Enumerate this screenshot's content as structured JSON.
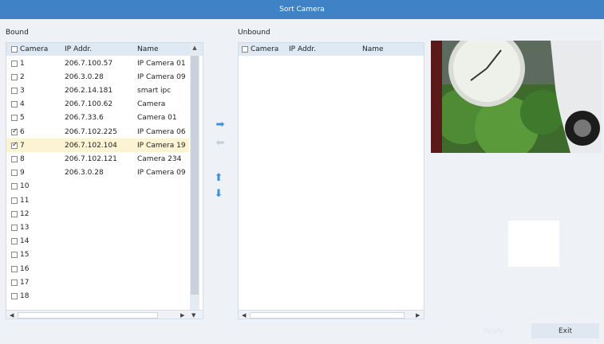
{
  "window": {
    "title": "Sort Camera"
  },
  "bound": {
    "label": "Bound",
    "columns": {
      "camera": "Camera",
      "ip": "IP Addr.",
      "name": "Name"
    },
    "rows": [
      {
        "cam": "1",
        "ip": "206.7.100.57",
        "name": "IP Camera 01",
        "checked": false
      },
      {
        "cam": "2",
        "ip": "206.3.0.28",
        "name": "IP Camera 09",
        "checked": false
      },
      {
        "cam": "3",
        "ip": "206.2.14.181",
        "name": "smart ipc",
        "checked": false
      },
      {
        "cam": "4",
        "ip": "206.7.100.62",
        "name": "Camera",
        "checked": false
      },
      {
        "cam": "5",
        "ip": "206.7.33.6",
        "name": "Camera 01",
        "checked": false
      },
      {
        "cam": "6",
        "ip": "206.7.102.225",
        "name": "IP Camera 06",
        "checked": true
      },
      {
        "cam": "7",
        "ip": "206.7.102.104",
        "name": "IP Camera 19",
        "checked": true
      },
      {
        "cam": "8",
        "ip": "206.7.102.121",
        "name": "Camera 234",
        "checked": false
      },
      {
        "cam": "9",
        "ip": "206.3.0.28",
        "name": "IP Camera 09",
        "checked": false
      },
      {
        "cam": "10",
        "ip": "",
        "name": "",
        "checked": false
      },
      {
        "cam": "11",
        "ip": "",
        "name": "",
        "checked": false
      },
      {
        "cam": "12",
        "ip": "",
        "name": "",
        "checked": false
      },
      {
        "cam": "13",
        "ip": "",
        "name": "",
        "checked": false
      },
      {
        "cam": "14",
        "ip": "",
        "name": "",
        "checked": false
      },
      {
        "cam": "15",
        "ip": "",
        "name": "",
        "checked": false
      },
      {
        "cam": "16",
        "ip": "",
        "name": "",
        "checked": false
      },
      {
        "cam": "17",
        "ip": "",
        "name": "",
        "checked": false
      },
      {
        "cam": "18",
        "ip": "",
        "name": "",
        "checked": false
      }
    ],
    "selected_row": 6
  },
  "unbound": {
    "label": "Unbound",
    "columns": {
      "camera": "Camera",
      "ip": "IP Addr.",
      "name": "Name"
    }
  },
  "controls": {
    "move_right_icon": "arrow-right-icon",
    "move_left_icon": "arrow-left-icon",
    "move_up_icon": "arrow-up-icon",
    "move_down_icon": "arrow-down-icon"
  },
  "buttons": {
    "apply": "Apply",
    "exit": "Exit"
  },
  "colors": {
    "titlebar": "#3f82c6",
    "accent_arrow": "#4a90d9",
    "selected_row": "#fbf3d2"
  }
}
